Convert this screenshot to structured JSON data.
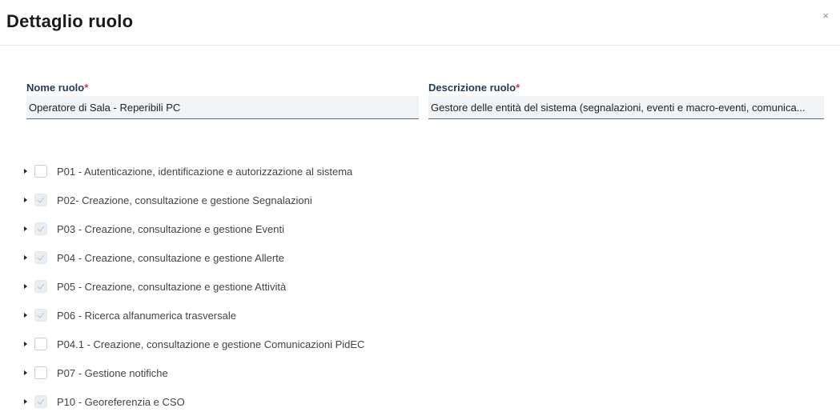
{
  "dialog": {
    "title": "Dettaglio ruolo",
    "close_symbol": "×"
  },
  "form": {
    "name": {
      "label": "Nome ruolo",
      "required_mark": "*",
      "value": "Operatore di Sala - Reperibili PC"
    },
    "description": {
      "label": "Descrizione ruolo",
      "required_mark": "*",
      "value": "Gestore delle entità del sistema (segnalazioni, eventi e macro-eventi, comunica..."
    }
  },
  "permissions": [
    {
      "label": "P01 - Autenticazione, identificazione e autorizzazione al sistema",
      "checked": false
    },
    {
      "label": "P02- Creazione, consultazione e gestione Segnalazioni",
      "checked": true
    },
    {
      "label": "P03 - Creazione, consultazione e gestione Eventi",
      "checked": true
    },
    {
      "label": "P04 - Creazione, consultazione e gestione Allerte",
      "checked": true
    },
    {
      "label": "P05 - Creazione, consultazione e gestione Attività",
      "checked": true
    },
    {
      "label": "P06 - Ricerca alfanumerica trasversale",
      "checked": true
    },
    {
      "label": "P04.1 - Creazione, consultazione e gestione Comunicazioni PidEC",
      "checked": false
    },
    {
      "label": "P07 - Gestione notifiche",
      "checked": false
    },
    {
      "label": "P10 - Georeferenzia e CSO",
      "checked": true
    }
  ]
}
